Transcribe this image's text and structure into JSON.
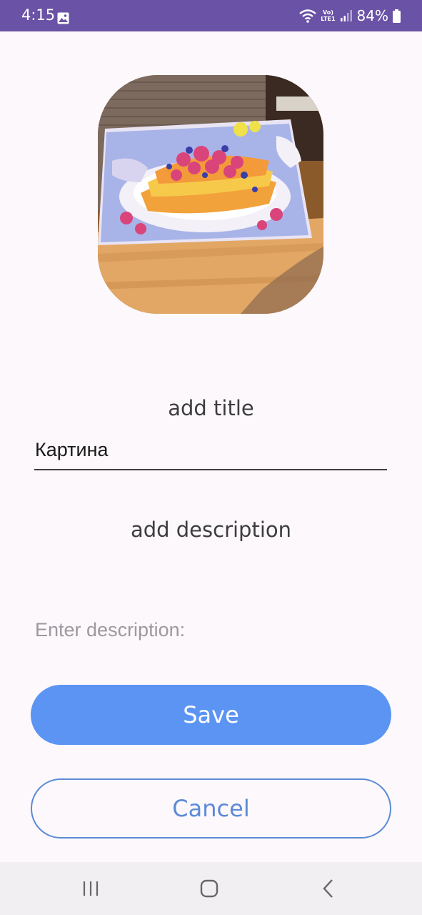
{
  "status_bar": {
    "time": "4:15",
    "network_label_top": "Vo)",
    "network_label_bottom": "LTE1",
    "battery_percent": "84%",
    "background_color": "#6a53a6",
    "icons": [
      "gallery-icon",
      "wifi-icon",
      "signal-icon",
      "battery-icon"
    ]
  },
  "image": {
    "icon": "photo-image"
  },
  "form": {
    "title_label": "add title",
    "title_value": "Картина",
    "description_label": "add description",
    "description_placeholder": "Enter description:"
  },
  "buttons": {
    "save_label": "Save",
    "cancel_label": "Cancel",
    "save_color": "#5b94f3",
    "cancel_border_color": "#5b8bd6"
  },
  "nav_bar": {
    "icons": [
      "recent-apps-icon",
      "home-icon",
      "back-icon"
    ]
  }
}
